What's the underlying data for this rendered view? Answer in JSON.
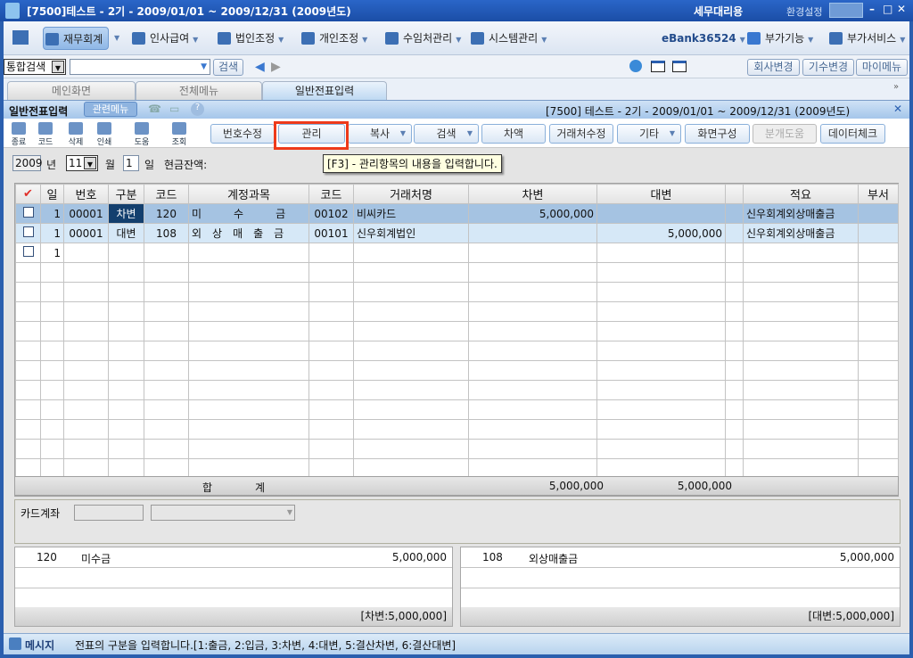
{
  "window": {
    "title": "[7500]테스트 - 2기 - 2009/01/01 ~ 2009/12/31 (2009년도)",
    "mode": "세무대리용",
    "settings": "환경설정"
  },
  "menu": [
    {
      "label": "재무회계"
    },
    {
      "label": "인사급여"
    },
    {
      "label": "법인조정"
    },
    {
      "label": "개인조정"
    },
    {
      "label": "수임처관리"
    },
    {
      "label": "시스템관리"
    }
  ],
  "menu_right": {
    "ebank": "eBank36524",
    "addon": "부가기능",
    "service": "부가서비스"
  },
  "searchbar": {
    "type": "통합검색",
    "value": "",
    "search": "검색",
    "company_change": "회사변경",
    "period_change": "기수변경",
    "my_menu": "마이메뉴"
  },
  "tabs": [
    {
      "label": "메인화면"
    },
    {
      "label": "전체메뉴"
    },
    {
      "label": "일반전표입력"
    }
  ],
  "subheader": {
    "title": "일반전표입력",
    "related": "관련메뉴",
    "info": "[7500] 테스트 - 2기 - 2009/01/01 ~ 2009/12/31 (2009년도)"
  },
  "toolbar_icons": [
    "종료",
    "코드",
    "삭제",
    "인쇄",
    "도움",
    "조회"
  ],
  "toolbar_buttons": {
    "renumber": "번호수정",
    "manage": "관리",
    "copy": "복사",
    "search": "검색",
    "diff": "차액",
    "vendor_edit": "거래처수정",
    "etc": "기타",
    "layout": "화면구성",
    "split": "분개도움",
    "datacheck": "데이터체크"
  },
  "tooltip": "[F3] - 관리항목의 내용을 입력합니다.",
  "filter": {
    "year": "2009",
    "year_label": "년",
    "month": "11",
    "month_label": "월",
    "day": "1",
    "day_label": "일",
    "cash_label": "현금잔액:"
  },
  "grid": {
    "headers": [
      "",
      "일",
      "번호",
      "구분",
      "코드",
      "계정과목",
      "코드",
      "거래처명",
      "차변",
      "대변",
      "",
      "적요",
      "부서"
    ],
    "rows": [
      [
        "",
        "1",
        "00001",
        "차변",
        "120",
        "미　　　수　　　금",
        "00102",
        "비씨카드",
        "5,000,000",
        "",
        "",
        "신우회계외상매출금",
        ""
      ],
      [
        "",
        "1",
        "00001",
        "대변",
        "108",
        "외　상　매　출　금",
        "00101",
        "신우회계법인",
        "",
        "5,000,000",
        "",
        "신우회계외상매출금",
        ""
      ],
      [
        "",
        "1",
        "",
        "",
        "",
        "",
        "",
        "",
        "",
        "",
        "",
        "",
        ""
      ]
    ],
    "total_label": "합　　　　계",
    "total_debit": "5,000,000",
    "total_credit": "5,000,000"
  },
  "card": {
    "label": "카드계좌",
    "code": "",
    "name": ""
  },
  "summary_left": {
    "code": "120",
    "name": "미수금",
    "amount": "5,000,000",
    "footer": "[차변:5,000,000]"
  },
  "summary_right": {
    "code": "108",
    "name": "외상매출금",
    "amount": "5,000,000",
    "footer": "[대변:5,000,000]"
  },
  "status": {
    "label": "메시지",
    "text": "전표의 구분을 입력합니다.[1:출금, 2:입금, 3:차변, 4:대변, 5:결산차변, 6:결산대변]"
  }
}
